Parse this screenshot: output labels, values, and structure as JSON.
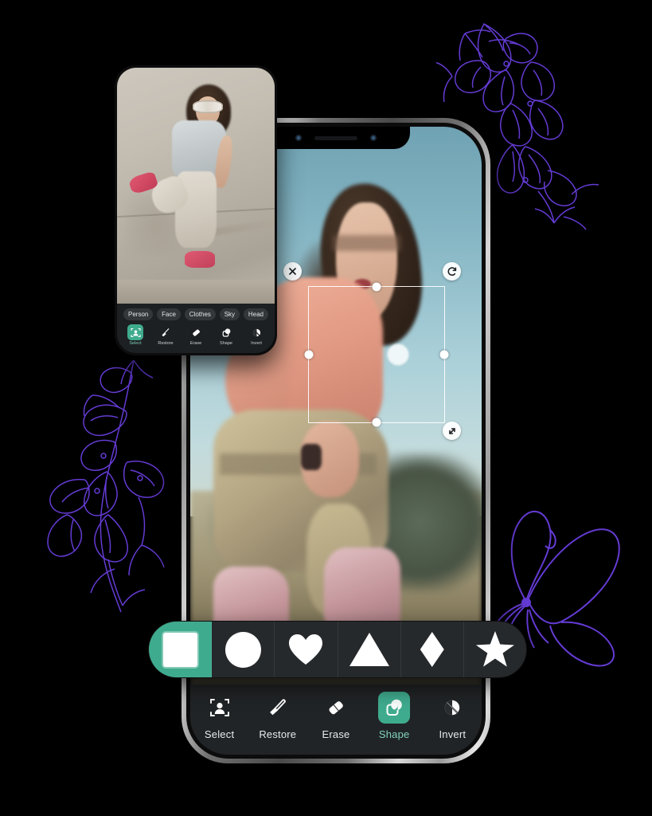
{
  "app": {
    "accent_color": "#3fab8e",
    "toolbar_bg": "#212426",
    "shape_bar_bg": "#26292b"
  },
  "main_phone": {
    "notch": {
      "sensor_left_name": "front-camera-sensor",
      "speaker_name": "earpiece-speaker",
      "sensor_right_name": "proximity-sensor"
    },
    "canvas": {
      "photo_description": "Skateboarder in pink t-shirt and khaki shorts mid-air against blue sky",
      "selection": {
        "close_glyph": "✕",
        "rotate_glyph": "↻",
        "resize_glyph": "⤡",
        "handles": [
          "top",
          "right",
          "bottom",
          "left"
        ]
      }
    },
    "shape_picker": {
      "selected_index": 0,
      "shapes": [
        {
          "name": "square",
          "label": "Square"
        },
        {
          "name": "circle",
          "label": "Circle"
        },
        {
          "name": "heart",
          "label": "Heart"
        },
        {
          "name": "triangle",
          "label": "Triangle"
        },
        {
          "name": "diamond",
          "label": "Diamond"
        },
        {
          "name": "star",
          "label": "Star"
        }
      ]
    },
    "toolbar": {
      "active_index": 3,
      "tools": [
        {
          "label": "Select",
          "icon": "person-select-icon"
        },
        {
          "label": "Restore",
          "icon": "brush-icon"
        },
        {
          "label": "Erase",
          "icon": "eraser-icon"
        },
        {
          "label": "Shape",
          "icon": "shape-overlap-icon"
        },
        {
          "label": "Invert",
          "icon": "invert-circle-icon"
        }
      ]
    }
  },
  "small_phone": {
    "canvas": {
      "photo_description": "Girl with white sunglasses leaning against a concrete wall, one leg raised, pink sneakers"
    },
    "tabs": {
      "items": [
        "Person",
        "Face",
        "Clothes",
        "Sky",
        "Head"
      ]
    },
    "toolbar": {
      "active_index": 0,
      "tools": [
        {
          "label": "Select",
          "icon": "person-select-icon"
        },
        {
          "label": "Restore",
          "icon": "brush-icon"
        },
        {
          "label": "Erase",
          "icon": "eraser-icon"
        },
        {
          "label": "Shape",
          "icon": "shape-overlap-icon"
        },
        {
          "label": "Invert",
          "icon": "invert-circle-icon"
        }
      ]
    }
  },
  "decorations": {
    "line_art_color": "#6a3fe0",
    "items": [
      {
        "name": "floral-branch-top-right"
      },
      {
        "name": "floral-vine-left"
      },
      {
        "name": "butterfly-right"
      }
    ]
  }
}
